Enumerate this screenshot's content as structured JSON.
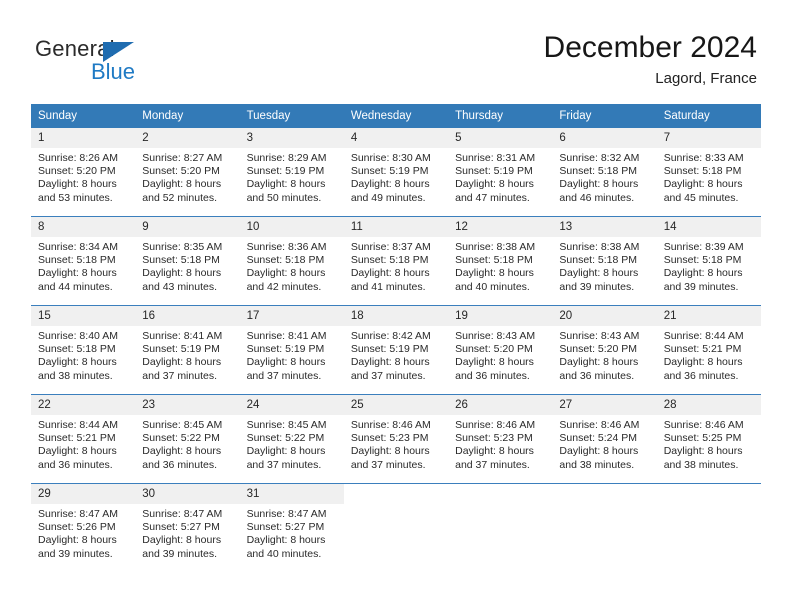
{
  "logo": {
    "word_one": "General",
    "word_two": "Blue",
    "triangle_icon": "blue-triangle-icon",
    "brand_blue": "#1f7ac4"
  },
  "header": {
    "title": "December 2024",
    "subtitle": "Lagord, France"
  },
  "theme": {
    "header_bg": "#337ab7",
    "daynum_bg": "#f0f0f0",
    "row_divider": "#3b7fbd",
    "text": "#2a2a2a"
  },
  "calendar": {
    "weekday_headers": [
      "Sunday",
      "Monday",
      "Tuesday",
      "Wednesday",
      "Thursday",
      "Friday",
      "Saturday"
    ],
    "weeks": [
      [
        {
          "day": "1",
          "sunrise": "Sunrise: 8:26 AM",
          "sunset": "Sunset: 5:20 PM",
          "daylight_line1": "Daylight: 8 hours",
          "daylight_line2": "and 53 minutes."
        },
        {
          "day": "2",
          "sunrise": "Sunrise: 8:27 AM",
          "sunset": "Sunset: 5:20 PM",
          "daylight_line1": "Daylight: 8 hours",
          "daylight_line2": "and 52 minutes."
        },
        {
          "day": "3",
          "sunrise": "Sunrise: 8:29 AM",
          "sunset": "Sunset: 5:19 PM",
          "daylight_line1": "Daylight: 8 hours",
          "daylight_line2": "and 50 minutes."
        },
        {
          "day": "4",
          "sunrise": "Sunrise: 8:30 AM",
          "sunset": "Sunset: 5:19 PM",
          "daylight_line1": "Daylight: 8 hours",
          "daylight_line2": "and 49 minutes."
        },
        {
          "day": "5",
          "sunrise": "Sunrise: 8:31 AM",
          "sunset": "Sunset: 5:19 PM",
          "daylight_line1": "Daylight: 8 hours",
          "daylight_line2": "and 47 minutes."
        },
        {
          "day": "6",
          "sunrise": "Sunrise: 8:32 AM",
          "sunset": "Sunset: 5:18 PM",
          "daylight_line1": "Daylight: 8 hours",
          "daylight_line2": "and 46 minutes."
        },
        {
          "day": "7",
          "sunrise": "Sunrise: 8:33 AM",
          "sunset": "Sunset: 5:18 PM",
          "daylight_line1": "Daylight: 8 hours",
          "daylight_line2": "and 45 minutes."
        }
      ],
      [
        {
          "day": "8",
          "sunrise": "Sunrise: 8:34 AM",
          "sunset": "Sunset: 5:18 PM",
          "daylight_line1": "Daylight: 8 hours",
          "daylight_line2": "and 44 minutes."
        },
        {
          "day": "9",
          "sunrise": "Sunrise: 8:35 AM",
          "sunset": "Sunset: 5:18 PM",
          "daylight_line1": "Daylight: 8 hours",
          "daylight_line2": "and 43 minutes."
        },
        {
          "day": "10",
          "sunrise": "Sunrise: 8:36 AM",
          "sunset": "Sunset: 5:18 PM",
          "daylight_line1": "Daylight: 8 hours",
          "daylight_line2": "and 42 minutes."
        },
        {
          "day": "11",
          "sunrise": "Sunrise: 8:37 AM",
          "sunset": "Sunset: 5:18 PM",
          "daylight_line1": "Daylight: 8 hours",
          "daylight_line2": "and 41 minutes."
        },
        {
          "day": "12",
          "sunrise": "Sunrise: 8:38 AM",
          "sunset": "Sunset: 5:18 PM",
          "daylight_line1": "Daylight: 8 hours",
          "daylight_line2": "and 40 minutes."
        },
        {
          "day": "13",
          "sunrise": "Sunrise: 8:38 AM",
          "sunset": "Sunset: 5:18 PM",
          "daylight_line1": "Daylight: 8 hours",
          "daylight_line2": "and 39 minutes."
        },
        {
          "day": "14",
          "sunrise": "Sunrise: 8:39 AM",
          "sunset": "Sunset: 5:18 PM",
          "daylight_line1": "Daylight: 8 hours",
          "daylight_line2": "and 39 minutes."
        }
      ],
      [
        {
          "day": "15",
          "sunrise": "Sunrise: 8:40 AM",
          "sunset": "Sunset: 5:18 PM",
          "daylight_line1": "Daylight: 8 hours",
          "daylight_line2": "and 38 minutes."
        },
        {
          "day": "16",
          "sunrise": "Sunrise: 8:41 AM",
          "sunset": "Sunset: 5:19 PM",
          "daylight_line1": "Daylight: 8 hours",
          "daylight_line2": "and 37 minutes."
        },
        {
          "day": "17",
          "sunrise": "Sunrise: 8:41 AM",
          "sunset": "Sunset: 5:19 PM",
          "daylight_line1": "Daylight: 8 hours",
          "daylight_line2": "and 37 minutes."
        },
        {
          "day": "18",
          "sunrise": "Sunrise: 8:42 AM",
          "sunset": "Sunset: 5:19 PM",
          "daylight_line1": "Daylight: 8 hours",
          "daylight_line2": "and 37 minutes."
        },
        {
          "day": "19",
          "sunrise": "Sunrise: 8:43 AM",
          "sunset": "Sunset: 5:20 PM",
          "daylight_line1": "Daylight: 8 hours",
          "daylight_line2": "and 36 minutes."
        },
        {
          "day": "20",
          "sunrise": "Sunrise: 8:43 AM",
          "sunset": "Sunset: 5:20 PM",
          "daylight_line1": "Daylight: 8 hours",
          "daylight_line2": "and 36 minutes."
        },
        {
          "day": "21",
          "sunrise": "Sunrise: 8:44 AM",
          "sunset": "Sunset: 5:21 PM",
          "daylight_line1": "Daylight: 8 hours",
          "daylight_line2": "and 36 minutes."
        }
      ],
      [
        {
          "day": "22",
          "sunrise": "Sunrise: 8:44 AM",
          "sunset": "Sunset: 5:21 PM",
          "daylight_line1": "Daylight: 8 hours",
          "daylight_line2": "and 36 minutes."
        },
        {
          "day": "23",
          "sunrise": "Sunrise: 8:45 AM",
          "sunset": "Sunset: 5:22 PM",
          "daylight_line1": "Daylight: 8 hours",
          "daylight_line2": "and 36 minutes."
        },
        {
          "day": "24",
          "sunrise": "Sunrise: 8:45 AM",
          "sunset": "Sunset: 5:22 PM",
          "daylight_line1": "Daylight: 8 hours",
          "daylight_line2": "and 37 minutes."
        },
        {
          "day": "25",
          "sunrise": "Sunrise: 8:46 AM",
          "sunset": "Sunset: 5:23 PM",
          "daylight_line1": "Daylight: 8 hours",
          "daylight_line2": "and 37 minutes."
        },
        {
          "day": "26",
          "sunrise": "Sunrise: 8:46 AM",
          "sunset": "Sunset: 5:23 PM",
          "daylight_line1": "Daylight: 8 hours",
          "daylight_line2": "and 37 minutes."
        },
        {
          "day": "27",
          "sunrise": "Sunrise: 8:46 AM",
          "sunset": "Sunset: 5:24 PM",
          "daylight_line1": "Daylight: 8 hours",
          "daylight_line2": "and 38 minutes."
        },
        {
          "day": "28",
          "sunrise": "Sunrise: 8:46 AM",
          "sunset": "Sunset: 5:25 PM",
          "daylight_line1": "Daylight: 8 hours",
          "daylight_line2": "and 38 minutes."
        }
      ],
      [
        {
          "day": "29",
          "sunrise": "Sunrise: 8:47 AM",
          "sunset": "Sunset: 5:26 PM",
          "daylight_line1": "Daylight: 8 hours",
          "daylight_line2": "and 39 minutes."
        },
        {
          "day": "30",
          "sunrise": "Sunrise: 8:47 AM",
          "sunset": "Sunset: 5:27 PM",
          "daylight_line1": "Daylight: 8 hours",
          "daylight_line2": "and 39 minutes."
        },
        {
          "day": "31",
          "sunrise": "Sunrise: 8:47 AM",
          "sunset": "Sunset: 5:27 PM",
          "daylight_line1": "Daylight: 8 hours",
          "daylight_line2": "and 40 minutes."
        },
        {
          "day": "",
          "sunrise": "",
          "sunset": "",
          "daylight_line1": "",
          "daylight_line2": ""
        },
        {
          "day": "",
          "sunrise": "",
          "sunset": "",
          "daylight_line1": "",
          "daylight_line2": ""
        },
        {
          "day": "",
          "sunrise": "",
          "sunset": "",
          "daylight_line1": "",
          "daylight_line2": ""
        },
        {
          "day": "",
          "sunrise": "",
          "sunset": "",
          "daylight_line1": "",
          "daylight_line2": ""
        }
      ]
    ]
  }
}
